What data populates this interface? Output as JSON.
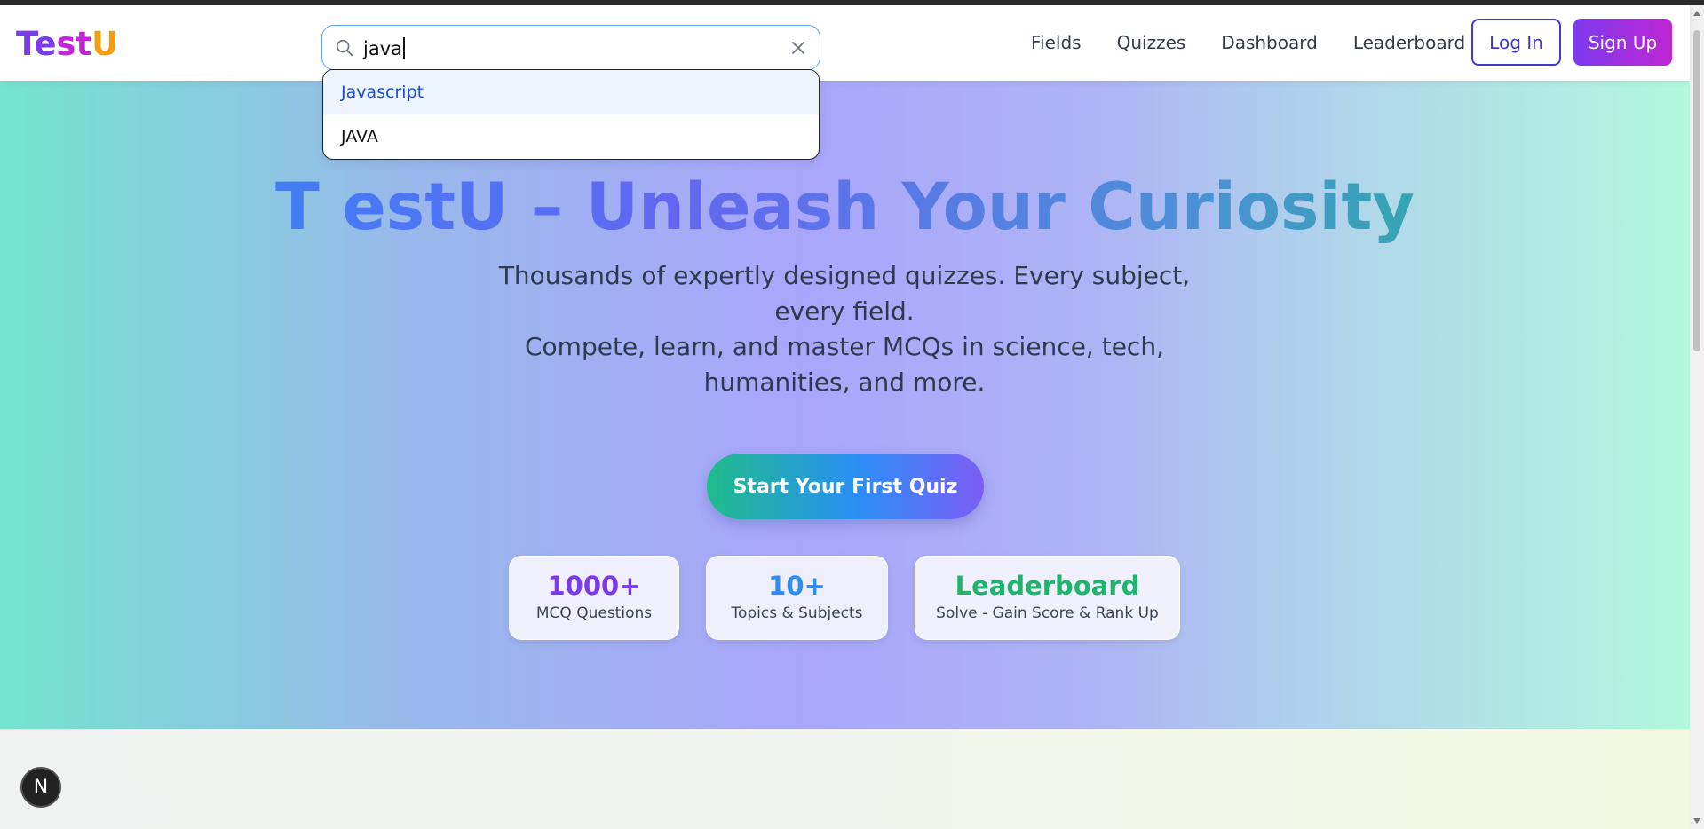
{
  "brand": {
    "part1": "Te",
    "part2": "st",
    "part3": "U"
  },
  "search": {
    "value": "java",
    "icon": "search-icon",
    "clear_icon": "close-icon"
  },
  "suggestions": [
    {
      "label": "Javascript",
      "highlighted": true
    },
    {
      "label": "JAVA",
      "highlighted": false
    }
  ],
  "nav": {
    "links": [
      "Fields",
      "Quizzes",
      "Dashboard",
      "Leaderboard"
    ],
    "login": "Log In",
    "signup": "Sign Up"
  },
  "hero": {
    "title": "T estU – Unleash Your Curiosity",
    "subtitle_line1": "Thousands of expertly designed quizzes. Every subject, every field.",
    "subtitle_line2": "Compete, learn, and master MCQs in science, tech, humanities, and more.",
    "cta": "Start Your First Quiz"
  },
  "stats": [
    {
      "value": "1000+",
      "label": "MCQ Questions",
      "color": "#7c3aed"
    },
    {
      "value": "10+",
      "label": "Topics & Subjects",
      "color": "#2b8ef7"
    },
    {
      "value": "Leaderboard",
      "label": "Solve - Gain Score & Rank Up",
      "color": "#1fb36d"
    }
  ],
  "fab": {
    "label": "N"
  },
  "colors": {
    "accent": "#4338ca",
    "brand_purple": "#7c3aed",
    "brand_pink": "#c026d3",
    "brand_yellow": "#f59e0b"
  }
}
